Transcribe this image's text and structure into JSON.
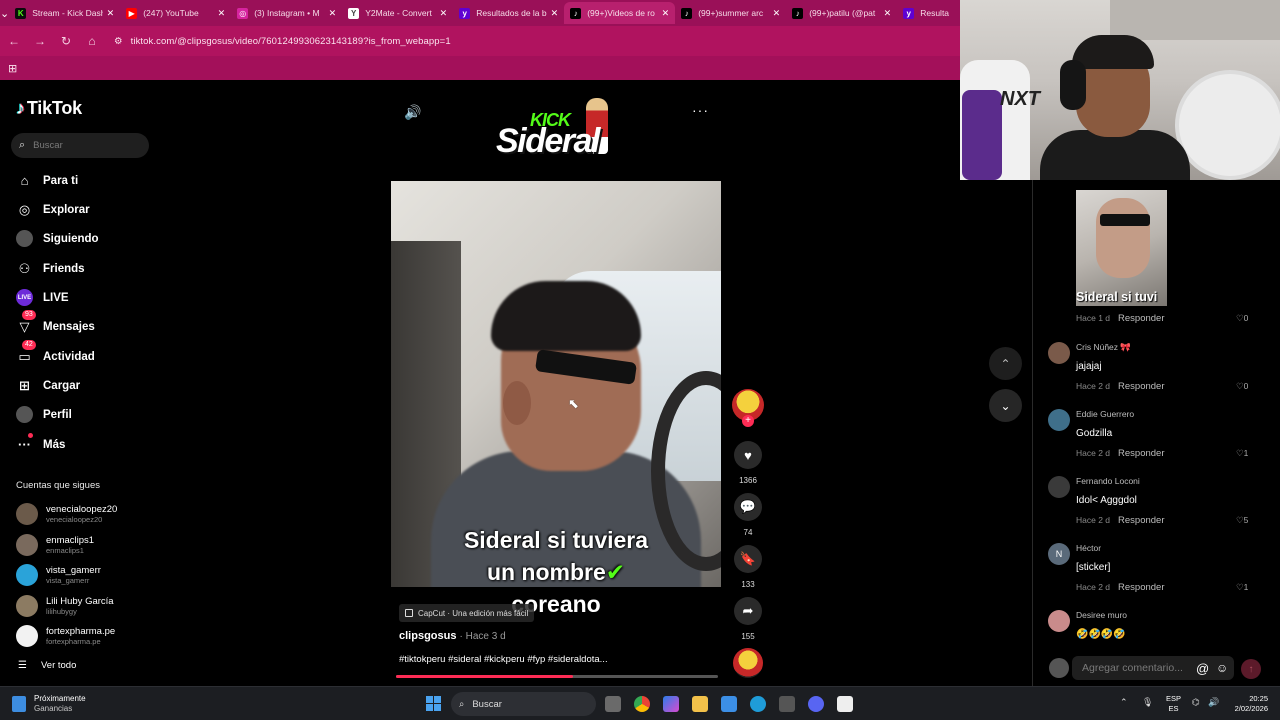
{
  "browser": {
    "tabs": [
      {
        "title": "Stream - Kick Dash",
        "fav_color": "#0b0b0b",
        "fav_glyph": "K",
        "fav_glyph_color": "#53fc18"
      },
      {
        "title": "(247) YouTube",
        "fav_color": "#ff0000",
        "fav_glyph": "▶",
        "fav_glyph_color": "#ffffff"
      },
      {
        "title": "(3) Instagram • M",
        "fav_color": "#d6249f",
        "fav_glyph": "◎",
        "fav_glyph_color": "#ffffff"
      },
      {
        "title": "Y2Mate - Convert",
        "fav_color": "#ffffff",
        "fav_glyph": "Y",
        "fav_glyph_color": "#444444"
      },
      {
        "title": "Resultados de la b",
        "fav_color": "#5f01d1",
        "fav_glyph": "y",
        "fav_glyph_color": "#ffffff"
      },
      {
        "title": "(99+)Videos de ro",
        "fav_color": "#000000",
        "fav_glyph": "♪",
        "fav_glyph_color": "#ffffff"
      },
      {
        "title": "(99+)summer arc",
        "fav_color": "#000000",
        "fav_glyph": "♪",
        "fav_glyph_color": "#ffffff"
      },
      {
        "title": "(99+)patilu (@pat",
        "fav_color": "#000000",
        "fav_glyph": "♪",
        "fav_glyph_color": "#ffffff"
      },
      {
        "title": "Resulta",
        "fav_color": "#5f01d1",
        "fav_glyph": "y",
        "fav_glyph_color": "#ffffff"
      }
    ],
    "close_glyph": "✕",
    "url": "tiktok.com/@clipsgosus/video/7601249930623143189?is_from_webapp=1"
  },
  "sidebar": {
    "logo": "TikTok",
    "search_placeholder": "Buscar",
    "menu": [
      {
        "label": "Para ti",
        "icon": "home-icon",
        "glyph": "⌂"
      },
      {
        "label": "Explorar",
        "icon": "compass-icon",
        "glyph": "◎"
      },
      {
        "label": "Siguiendo",
        "icon": "following-avatar-icon",
        "glyph": ""
      },
      {
        "label": "Friends",
        "icon": "friends-icon",
        "glyph": "⚇"
      },
      {
        "label": "LIVE",
        "icon": "live-icon",
        "glyph": "LIVE"
      },
      {
        "label": "Mensajes",
        "icon": "messages-icon",
        "glyph": "▽",
        "badge": "93"
      },
      {
        "label": "Actividad",
        "icon": "activity-icon",
        "glyph": "▭",
        "badge": "42"
      },
      {
        "label": "Cargar",
        "icon": "upload-icon",
        "glyph": "⊞"
      },
      {
        "label": "Perfil",
        "icon": "profile-avatar-icon",
        "glyph": ""
      },
      {
        "label": "Más",
        "icon": "more-dots-icon",
        "glyph": "···",
        "dot": true
      }
    ],
    "following_title": "Cuentas que sigues",
    "following": [
      {
        "name": "venecialoopez20",
        "handle": "venecialoopez20",
        "color": "#6b5a4a"
      },
      {
        "name": "enmaclips1",
        "handle": "enmaclips1",
        "color": "#7a6a5d"
      },
      {
        "name": "vista_gamerr",
        "handle": "vista_gamerr",
        "color": "#2aa3d9"
      },
      {
        "name": "Lili Huby García",
        "handle": "lilihubygy",
        "color": "#8c7b62"
      },
      {
        "name": "fortexpharma.pe",
        "handle": "fortexpharma.pe",
        "color": "#f2f2f2"
      }
    ],
    "see_all": "Ver todo"
  },
  "video": {
    "logo_top": "KICK",
    "logo_bottom": "Sideral",
    "caption_line1": "Sideral si tuviera",
    "caption_line2": "un nombre",
    "caption_line3": "coreano",
    "capcut_label": "CapCut · Una edición más fácil",
    "author": "clipsgosus",
    "posted": "· Hace 3 d",
    "description": "#tiktokperu #sideral #kickperu #fyp #sideraldota...",
    "progress": 0.55,
    "likes": "1366",
    "comments": "74",
    "saves": "133",
    "shares": "155"
  },
  "comments": {
    "thumb_caption": "Sideral si tuvi",
    "first_meta": "Hace 1 d",
    "first_likes": "0",
    "reply_label": "Responder",
    "items": [
      {
        "user": "Cris Núñez 🎀",
        "text": "jajajaj",
        "meta": "Hace 2 d",
        "likes": "0",
        "avatar_color": "#7a5a4a",
        "avatar_letter": ""
      },
      {
        "user": "Eddie Guerrero",
        "text": "Godzilla",
        "meta": "Hace 2 d",
        "likes": "1",
        "avatar_color": "#3f6f8a",
        "avatar_letter": ""
      },
      {
        "user": "Fernando Loconi",
        "text": "Idol< Agggdol",
        "meta": "Hace 2 d",
        "likes": "5",
        "avatar_color": "#3a3a3a",
        "avatar_letter": ""
      },
      {
        "user": "Héctor",
        "text": "[sticker]",
        "meta": "Hace 2 d",
        "likes": "1",
        "avatar_color": "#5a6a7a",
        "avatar_letter": "N"
      },
      {
        "user": "Desiree muro",
        "text": "🤣🤣🤣🤣",
        "meta": "",
        "likes": "",
        "avatar_color": "#c98b8b",
        "avatar_letter": ""
      }
    ],
    "add_placeholder": "Agregar comentario...",
    "at_glyph": "@",
    "emoji_glyph": "☺"
  },
  "taskbar": {
    "weather_line1": "Próximamente",
    "weather_line2": "Ganancias",
    "search_placeholder": "Buscar",
    "lang_line1": "ESP",
    "lang_line2": "ES",
    "time": "20:25",
    "date": "2/02/2026"
  }
}
